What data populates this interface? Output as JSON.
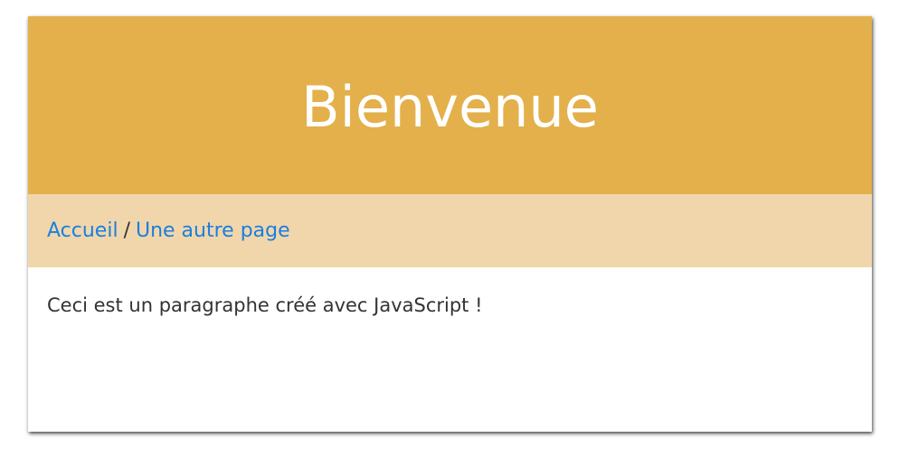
{
  "header": {
    "title": "Bienvenue"
  },
  "breadcrumb": {
    "links": [
      {
        "label": "Accueil"
      },
      {
        "label": "Une autre page"
      }
    ],
    "separator": "/"
  },
  "main": {
    "paragraph": "Ceci est un paragraphe créé avec JavaScript !"
  },
  "colors": {
    "banner": "#e3b04b",
    "breadcrumb_bg": "#f1d6ab",
    "link": "#1a7fe0",
    "text": "#333333"
  }
}
